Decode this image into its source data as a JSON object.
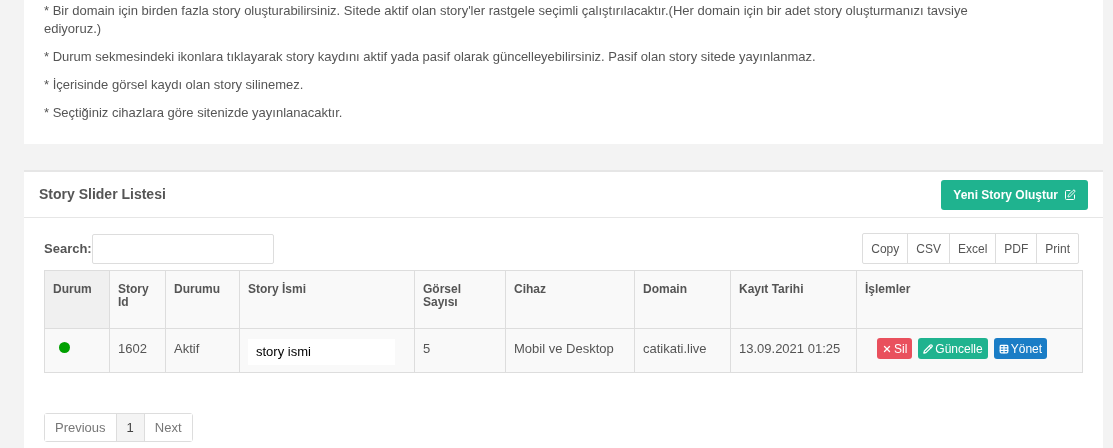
{
  "notes": [
    "* Bir domain için birden fazla story oluşturabilirsiniz. Sitede aktif olan story'ler rastgele seçimli çalıştırılacaktır.(Her domain için bir adet story oluşturmanızı tavsiye ediyoruz.)",
    "* Durum sekmesindeki ikonlara tıklayarak story kaydını aktif yada pasif olarak güncelleyebilirsiniz. Pasif olan story sitede yayınlanmaz.",
    "* İçerisinde görsel kaydı olan story silinemez.",
    "* Seçtiğiniz cihazlara göre sitenizde yayınlanacaktır."
  ],
  "panel": {
    "title": "Story Slider Listesi",
    "new_button": "Yeni Story Oluştur"
  },
  "search": {
    "label": "Search:"
  },
  "export_buttons": [
    "Copy",
    "CSV",
    "Excel",
    "PDF",
    "Print"
  ],
  "table": {
    "columns": [
      "Durum",
      "Story Id",
      "Durumu",
      "Story İsmi",
      "Görsel Sayısı",
      "Cihaz",
      "Domain",
      "Kayıt Tarihi",
      "İşlemler"
    ],
    "rows": [
      {
        "color": "#00a000",
        "id": "1602",
        "state": "Aktif",
        "name": "story ismi",
        "count": "5",
        "device": "Mobil ve Desktop",
        "domain": "catikati.live",
        "date": "13.09.2021 01:25",
        "actions": [
          {
            "kind": "delete",
            "label": "Sil"
          },
          {
            "kind": "edit",
            "label": "Güncelle"
          },
          {
            "kind": "manage",
            "label": "Yönet"
          }
        ]
      }
    ]
  },
  "pagination": [
    {
      "label": "Previous",
      "selected": false
    },
    {
      "label": "1",
      "selected": true
    },
    {
      "label": "Next",
      "selected": false
    }
  ]
}
